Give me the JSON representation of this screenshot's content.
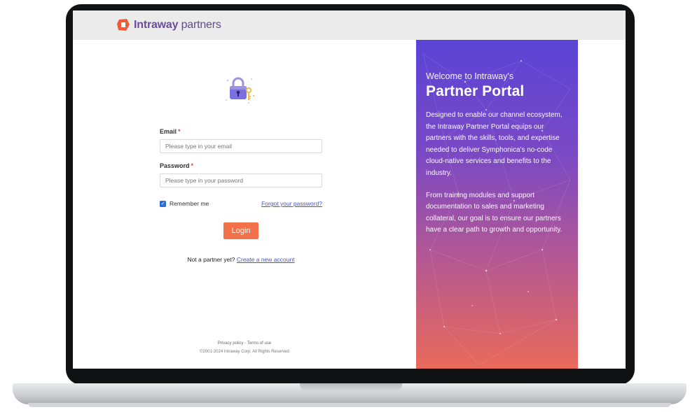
{
  "brand": {
    "name_a": "Intraway",
    "name_b": " partners"
  },
  "form": {
    "email_label": "Email",
    "email_placeholder": "Please type in your email",
    "password_label": "Password",
    "password_placeholder": "Please type in your password",
    "required_mark": "*",
    "remember_label": "Remember me",
    "remember_checked": true,
    "forgot_link": "Forgot your password?",
    "login_button": "Login",
    "signup_prompt": "Not a partner yet?",
    "signup_link": "Create a new account"
  },
  "footer": {
    "links": "Privacy policy - Terms of use",
    "copyright": "©2001-2024 Intraway Corp. All Rights Reserved"
  },
  "hero": {
    "welcome": "Welcome to Intraway's",
    "title": "Partner Portal",
    "paragraph1": "Designed to enable our channel ecosystem, the Intraway Partner Portal equips our partners with the skills, tools, and expertise needed to deliver Symphonica's no-code cloud-native services and benefits to the industry.",
    "paragraph2": "From training modules and support documentation to sales and marketing collateral, our goal is to ensure our partners have a clear path to growth and opportunity."
  },
  "colors": {
    "accent": "#f0714a",
    "link": "#4a57b8",
    "hero_top": "#5a44d6",
    "hero_bottom": "#e96a5a"
  },
  "icons": [
    "intraway-logo-icon",
    "lock-key-icon",
    "checkbox-checked-icon"
  ]
}
